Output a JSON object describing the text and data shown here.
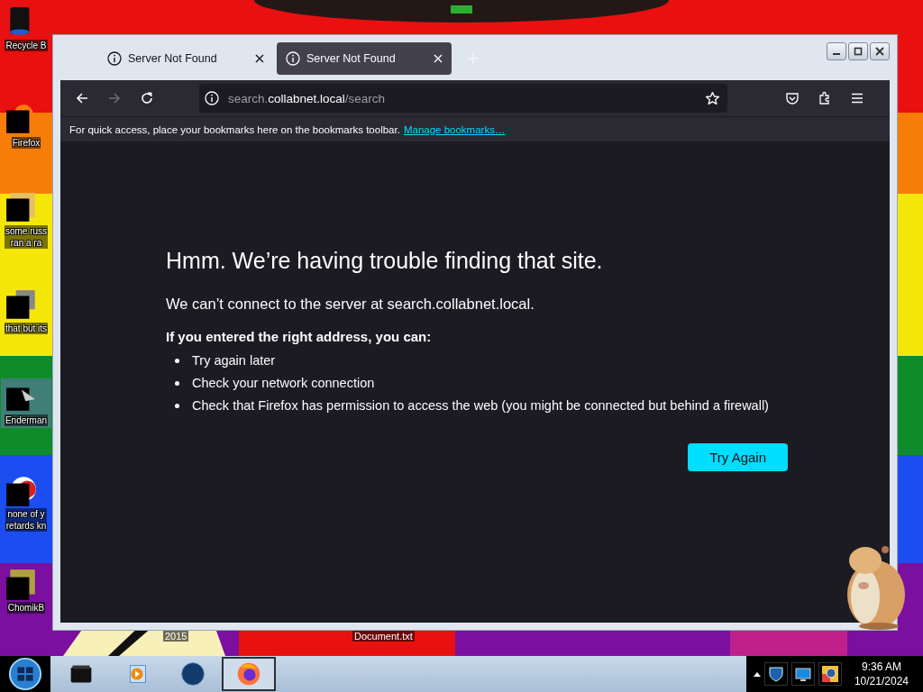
{
  "desktop": {
    "icons": [
      {
        "lines": [
          "Recycle B"
        ]
      },
      {
        "lines": [
          "Firefox"
        ]
      },
      {
        "lines": [
          "some russ",
          "ran a ra"
        ]
      },
      {
        "lines": [
          "that but its"
        ]
      },
      {
        "lines": [
          "Enderman"
        ],
        "selected": true
      },
      {
        "lines": [
          "none of y",
          "retards kn"
        ]
      },
      {
        "lines": [
          "ChomikB"
        ]
      }
    ],
    "bottom_labels": [
      "2015",
      "Document.txt"
    ]
  },
  "browser": {
    "tabs": [
      {
        "title": "Server Not Found",
        "selected": false
      },
      {
        "title": "Server Not Found",
        "selected": true
      }
    ],
    "forward": {
      "disabled": true
    },
    "url": {
      "prefix": "search.",
      "domain": "collabnet.local",
      "suffix": "/search"
    },
    "bookmarks_bar": {
      "text": "For quick access, place your bookmarks here on the bookmarks toolbar.",
      "link": "Manage bookmarks…"
    },
    "error": {
      "title": "Hmm. We’re having trouble finding that site.",
      "message": "We can’t connect to the server at search.collabnet.local.",
      "subtitle": "If you entered the right address, you can:",
      "items": [
        "Try again later",
        "Check your network connection",
        "Check that Firefox has permission to access the web (you might be connected but behind a firewall)"
      ],
      "button": "Try Again"
    }
  },
  "taskbar": {
    "apps": [
      {
        "selected": false
      },
      {
        "selected": false
      },
      {
        "selected": false
      },
      {
        "selected": true
      }
    ],
    "clock": {
      "time": "9:36 AM",
      "date": "10/21/2024"
    }
  }
}
